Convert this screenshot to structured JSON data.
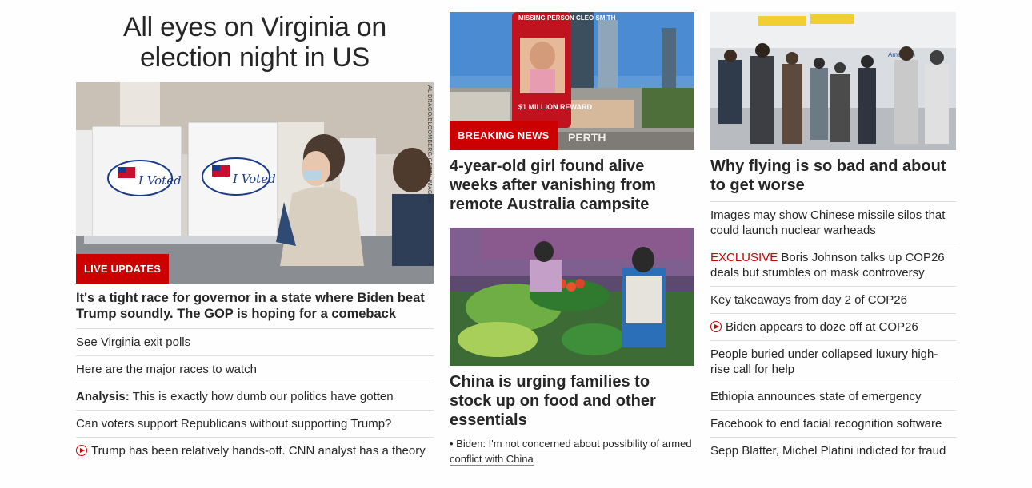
{
  "col1": {
    "title": "All eyes on Virginia on election night in US",
    "badge": "LIVE UPDATES",
    "photo_credit": "AL DRAGO/BLOOMBERG/GETTY IMAGES",
    "sticker_text": "I Voted",
    "headline": "It's a tight race for governor in a state where Biden beat Trump soundly. The GOP is hoping for a comeback",
    "links": [
      {
        "text": "See Virginia exit polls"
      },
      {
        "text": "Here are the major races to watch"
      },
      {
        "prefix": "Analysis:",
        "text": " This is exactly how dumb our politics have gotten"
      },
      {
        "text": "Can voters support Republicans without supporting Trump?"
      },
      {
        "video": true,
        "text": "Trump has been relatively hands-off. CNN analyst has a theory"
      }
    ]
  },
  "col2": {
    "story1": {
      "badge": "BREAKING NEWS",
      "billboard_top": "MISSING PERSON CLEO SMITH",
      "billboard_bottom": "$1 MILLION REWARD",
      "sign": "PERTH",
      "headline": "4-year-old girl found alive weeks after vanishing from remote Australia campsite"
    },
    "story2": {
      "headline": "China is urging families to stock up on food and other essentials",
      "sublink": "• Biden: I'm not concerned about possibility of armed conflict with China"
    }
  },
  "col3": {
    "headline": "Why flying is so bad and about to get worse",
    "airline_sign": "American",
    "links": [
      {
        "text": "Images may show Chinese missile silos that could launch nuclear warheads"
      },
      {
        "red_prefix": "EXCLUSIVE",
        "text": " Boris Johnson talks up COP26 deals but stumbles on mask controversy"
      },
      {
        "text": "Key takeaways from day 2 of COP26"
      },
      {
        "video": true,
        "text": "Biden appears to doze off at COP26"
      },
      {
        "text": "People buried under collapsed luxury high-rise call for help"
      },
      {
        "text": "Ethiopia announces state of emergency"
      },
      {
        "text": "Facebook to end facial recognition software"
      },
      {
        "text": "Sepp Blatter, Michel Platini indicted for fraud"
      }
    ]
  },
  "colors": {
    "accent_red": "#cc0000",
    "text": "#262626",
    "divider": "#dddddd"
  },
  "icons": {
    "video": "play-circle-icon"
  }
}
